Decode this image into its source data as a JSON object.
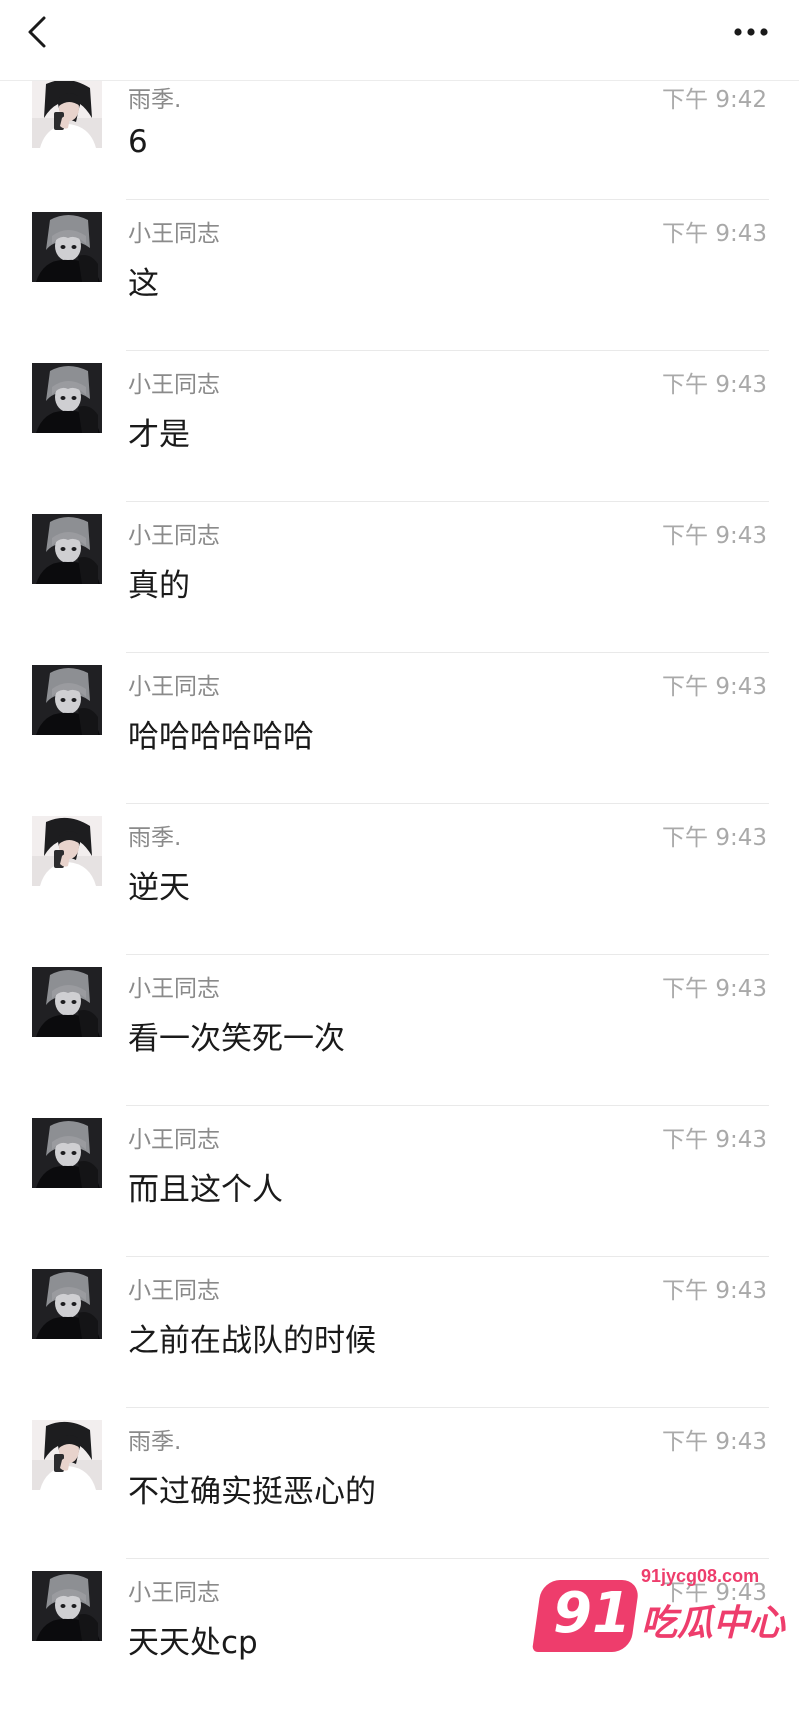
{
  "header": {
    "back_icon": "chevron-left-icon",
    "more_icon": "more-horizontal-icon"
  },
  "messages": [
    {
      "sender": "雨季.",
      "time": "下午 9:42",
      "text": "6",
      "avatar": "avatar-yuji"
    },
    {
      "sender": "小王同志",
      "time": "下午 9:43",
      "text": "这",
      "avatar": "avatar-xiaowang"
    },
    {
      "sender": "小王同志",
      "time": "下午 9:43",
      "text": "才是",
      "avatar": "avatar-xiaowang"
    },
    {
      "sender": "小王同志",
      "time": "下午 9:43",
      "text": "真的",
      "avatar": "avatar-xiaowang"
    },
    {
      "sender": "小王同志",
      "time": "下午 9:43",
      "text": "哈哈哈哈哈哈",
      "avatar": "avatar-xiaowang"
    },
    {
      "sender": "雨季.",
      "time": "下午 9:43",
      "text": "逆天",
      "avatar": "avatar-yuji"
    },
    {
      "sender": "小王同志",
      "time": "下午 9:43",
      "text": "看一次笑死一次",
      "avatar": "avatar-xiaowang"
    },
    {
      "sender": "小王同志",
      "time": "下午 9:43",
      "text": "而且这个人",
      "avatar": "avatar-xiaowang"
    },
    {
      "sender": "小王同志",
      "time": "下午 9:43",
      "text": "之前在战队的时候",
      "avatar": "avatar-xiaowang"
    },
    {
      "sender": "雨季.",
      "time": "下午 9:43",
      "text": "不过确实挺恶心的",
      "avatar": "avatar-yuji"
    },
    {
      "sender": "小王同志",
      "time": "下午 9:43",
      "text": "天天处cp",
      "avatar": "avatar-xiaowang"
    }
  ],
  "watermark": {
    "number": "91",
    "url": "91jycg08.com",
    "name": "吃瓜中心",
    "color": "#ee3d6c"
  }
}
